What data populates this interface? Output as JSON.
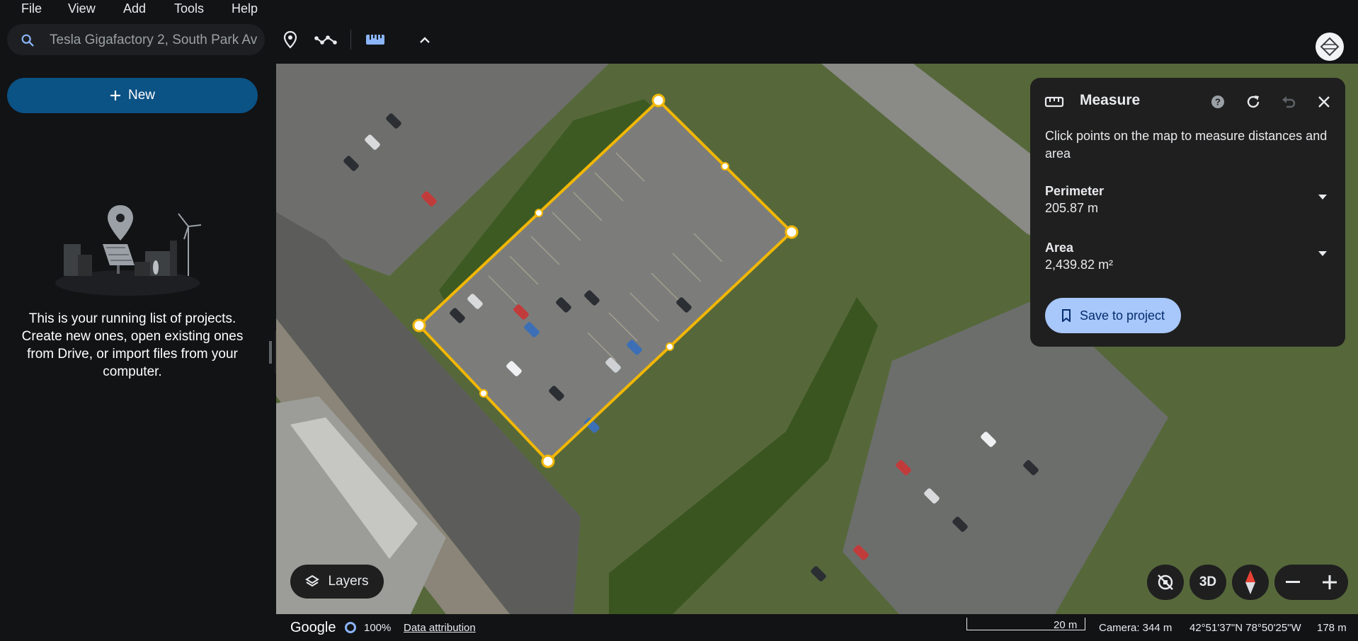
{
  "menu": {
    "items": [
      "File",
      "View",
      "Add",
      "Tools",
      "Help"
    ]
  },
  "search": {
    "placeholder": "Tesla Gigafactory 2, South Park Av",
    "icon": "search-icon"
  },
  "toolbar": {
    "icons": [
      "placemark-pin-icon",
      "path-route-icon",
      "ruler-icon",
      "chevron-up-icon"
    ]
  },
  "sidebar": {
    "new_label": "New",
    "empty_message": "This is your running list of projects. Create new ones, open existing ones from Drive, or import files from your computer."
  },
  "measure": {
    "title": "Measure",
    "description": "Click points on the map to measure distances and area",
    "perimeter_label": "Perimeter",
    "perimeter_value": "205.87 m",
    "area_label": "Area",
    "area_value": "2,439.82 m²",
    "save_label": "Save to project",
    "icons": [
      "ruler-icon",
      "help-icon",
      "refresh-icon",
      "undo-icon",
      "close-icon"
    ]
  },
  "map_controls": {
    "layers_label": "Layers",
    "mode_3d_label": "3D",
    "icons": [
      "auto-rotate-off-icon",
      "compass-icon",
      "zoom-out-icon",
      "zoom-in-icon"
    ]
  },
  "status": {
    "brand": "Google",
    "load_percent": "100%",
    "attribution_label": "Data attribution",
    "scale_label": "20 m",
    "camera": "Camera: 344 m",
    "coordinates": "42°51'37\"N 78°50'25\"W",
    "elevation": "178 m"
  },
  "colors": {
    "accent": "#0b5285",
    "save_button": "#a8c7fa",
    "measure_line": "#f2b705",
    "panel": "#1f1f1f"
  }
}
